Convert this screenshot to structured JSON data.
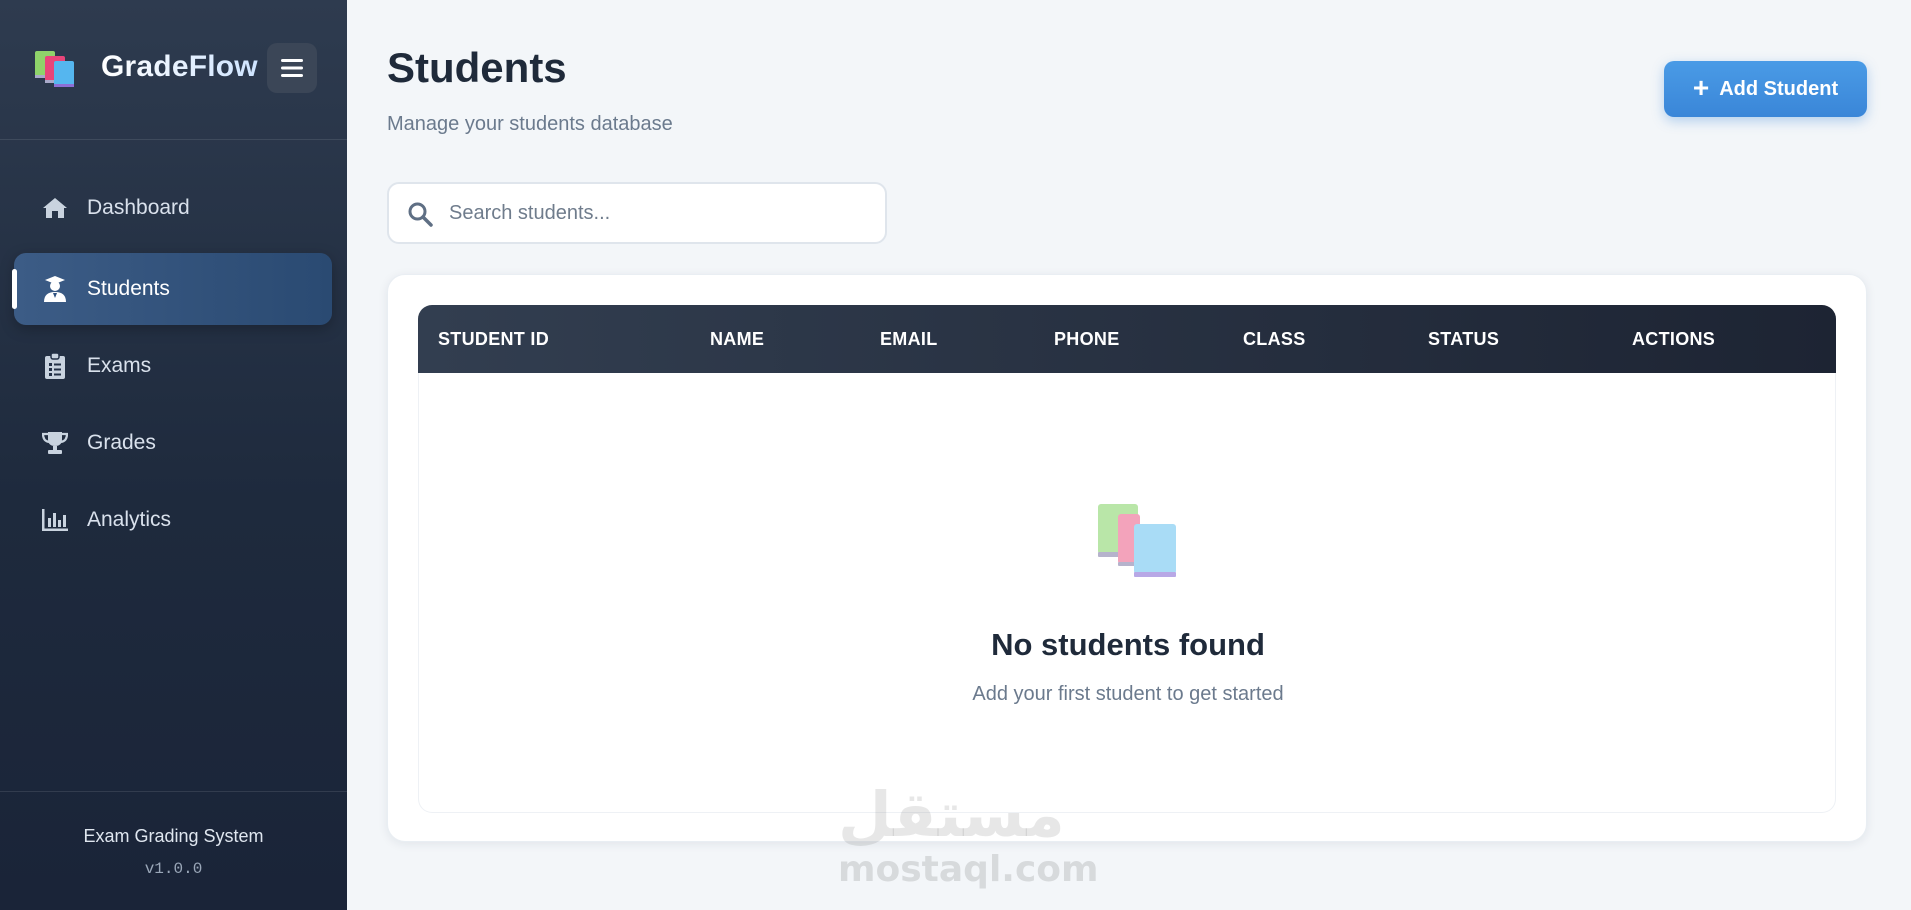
{
  "brand": {
    "name": "GradeFlow"
  },
  "sidebar": {
    "items": [
      {
        "label": "Dashboard",
        "icon": "home-icon",
        "active": false
      },
      {
        "label": "Students",
        "icon": "graduate-icon",
        "active": true
      },
      {
        "label": "Exams",
        "icon": "clipboard-icon",
        "active": false
      },
      {
        "label": "Grades",
        "icon": "trophy-icon",
        "active": false
      },
      {
        "label": "Analytics",
        "icon": "bar-chart-icon",
        "active": false
      }
    ],
    "footer": {
      "title": "Exam Grading System",
      "version": "v1.0.0"
    }
  },
  "header": {
    "title": "Students",
    "subtitle": "Manage your students database",
    "add_label": "Add Student"
  },
  "search": {
    "placeholder": "Search students...",
    "value": ""
  },
  "table": {
    "columns": [
      "STUDENT ID",
      "NAME",
      "EMAIL",
      "PHONE",
      "CLASS",
      "STATUS",
      "ACTIONS"
    ],
    "rows": []
  },
  "empty_state": {
    "title": "No students found",
    "subtitle": "Add your first student to get started"
  },
  "watermark": {
    "arabic": "مستقل",
    "latin": "mostaql.com"
  },
  "colors": {
    "sidebar_bg": "#1e2a3d",
    "accent": "#3a86d8",
    "active_item": "#2f5180",
    "table_header": "#232c3c",
    "text_dark": "#1f2a3a",
    "text_muted": "#6b7a8d"
  }
}
